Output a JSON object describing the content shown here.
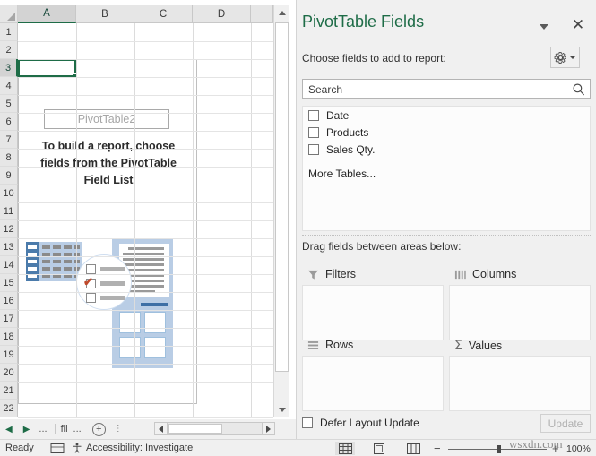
{
  "spreadsheet": {
    "column_headers": [
      "A",
      "B",
      "C",
      "D"
    ],
    "selected_column": "A",
    "row_headers": [
      "1",
      "2",
      "3",
      "4",
      "5",
      "6",
      "7",
      "8",
      "9",
      "10",
      "11",
      "12",
      "13",
      "14",
      "15",
      "16",
      "17",
      "18",
      "19",
      "20",
      "21",
      "22"
    ],
    "selected_row": "3",
    "active_cell": "A3",
    "pivot_placeholder": {
      "name": "PivotTable2",
      "hint": "To build a report, choose fields from the PivotTable Field List"
    },
    "tabbar": {
      "prev_label": "◀",
      "next_label": "▶",
      "left_dots": "...",
      "sheet_name": "fil",
      "sheet_dots": "...",
      "add_sheet_label": "+",
      "more_label": "⋮"
    }
  },
  "pane": {
    "title": "PivotTable Fields",
    "dropdown_icon": "chevron-down-icon",
    "close_label": "✕",
    "choose_label": "Choose fields to add to report:",
    "tools_icon": "gear-icon",
    "search": {
      "placeholder": "Search",
      "value": "",
      "icon": "search-icon"
    },
    "fields": [
      {
        "label": "Date",
        "checked": false
      },
      {
        "label": "Products",
        "checked": false
      },
      {
        "label": "Sales Qty.",
        "checked": false
      }
    ],
    "more_tables_label": "More Tables...",
    "drag_label": "Drag fields between areas below:",
    "areas": [
      {
        "label": "Filters",
        "icon": "filter-icon",
        "items": []
      },
      {
        "label": "Columns",
        "icon": "columns-icon",
        "items": []
      },
      {
        "label": "Rows",
        "icon": "rows-icon",
        "items": []
      },
      {
        "label": "Values",
        "icon": "sigma-icon",
        "items": []
      }
    ],
    "defer_label": "Defer Layout Update",
    "defer_checked": false,
    "update_label": "Update",
    "highlight_color": "#e8000d"
  },
  "statusbar": {
    "ready_label": "Ready",
    "accessibility_label": "Accessibility: Investigate",
    "view_normal_icon": "normal-view-icon",
    "view_pagelayout_icon": "page-layout-view-icon",
    "view_pagebreak_icon": "page-break-view-icon",
    "zoom_out_label": "−",
    "zoom_in_label": "+",
    "zoom_level": "100%"
  },
  "watermark": {
    "text": "wsxdn.com"
  }
}
